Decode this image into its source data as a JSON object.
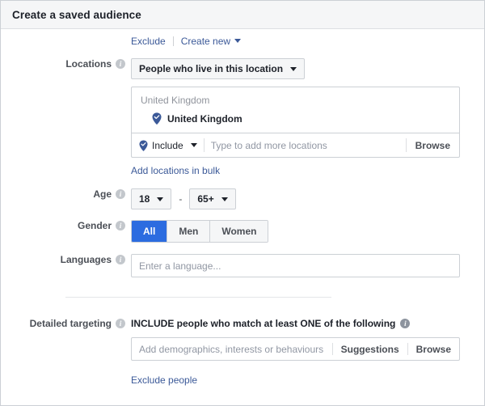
{
  "panel": {
    "title": "Create a saved audience"
  },
  "top_links": {
    "exclude_label": "Exclude",
    "create_new_label": "Create new"
  },
  "locations": {
    "label": "Locations",
    "mode_dropdown_value": "People who live in this location",
    "group_title": "United Kingdom",
    "selected_location": "United Kingdom",
    "include_label": "Include",
    "input_value": "",
    "input_placeholder": "Type to add more locations",
    "browse_label": "Browse",
    "bulk_link_label": "Add locations in bulk"
  },
  "age": {
    "label": "Age",
    "min_value": "18",
    "max_value": "65+",
    "separator": "-"
  },
  "gender": {
    "label": "Gender",
    "options": [
      {
        "label": "All",
        "selected": true
      },
      {
        "label": "Men",
        "selected": false
      },
      {
        "label": "Women",
        "selected": false
      }
    ]
  },
  "languages": {
    "label": "Languages",
    "input_value": "",
    "input_placeholder": "Enter a language..."
  },
  "detailed_targeting": {
    "label": "Detailed targeting",
    "heading": "INCLUDE people who match at least ONE of the following",
    "input_value": "",
    "input_placeholder": "Add demographics, interests or behaviours",
    "suggestions_label": "Suggestions",
    "browse_label": "Browse",
    "exclude_link_label": "Exclude people"
  },
  "icons": {
    "info": "i",
    "map_pin": "map-pin-check-icon",
    "caret_down": "chevron-down-icon"
  },
  "colors": {
    "accent_blue": "#2c6ce0",
    "link_blue": "#3b5998",
    "header_bg": "#f5f6f7",
    "border": "#ccd0d5",
    "text_dark": "#1d2129",
    "text_muted": "#90949c"
  }
}
